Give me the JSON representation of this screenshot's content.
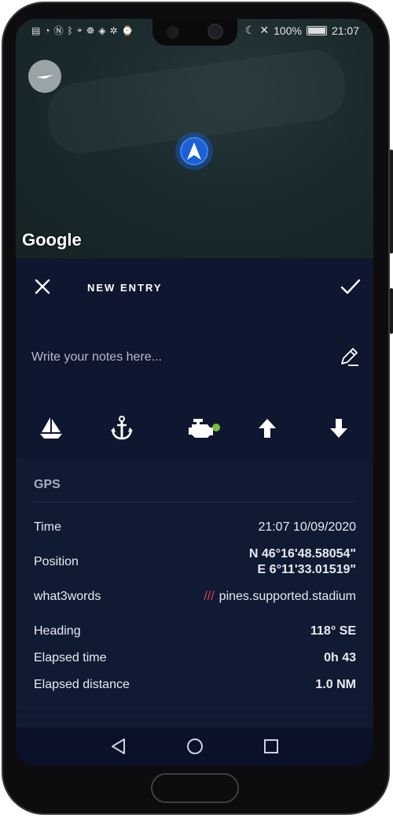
{
  "status": {
    "battery": "100%",
    "time": "21:07",
    "left_icons": [
      "data-icon",
      "wifi-icon",
      "nfc-icon",
      "bluetooth-icon",
      "location-icon",
      "helm-icon",
      "target-icon",
      "settings-icon",
      "watch-icon"
    ],
    "right_icons": [
      "moon-icon",
      "mute-icon",
      "battery-icon"
    ]
  },
  "map": {
    "provider": "Google"
  },
  "header": {
    "title": "NEW ENTRY"
  },
  "notes": {
    "placeholder": "Write your notes here..."
  },
  "quick_actions": [
    "sailboat-icon",
    "anchor-icon",
    "engine-icon",
    "arrow-up-icon",
    "arrow-down-icon"
  ],
  "engine_status_color": "#7bbf3a",
  "gps": {
    "title": "GPS",
    "time_label": "Time",
    "time_value": "21:07 10/09/2020",
    "position_label": "Position",
    "position_lat": "N 46°16'48.58054\"",
    "position_lon": "E 6°11'33.01519\"",
    "w3w_label": "what3words",
    "w3w_prefix": "///",
    "w3w_value": "pines.supported.stadium",
    "heading_label": "Heading",
    "heading_value": "118° SE",
    "elapsed_time_label": "Elapsed time",
    "elapsed_time_value": "0h 43",
    "elapsed_distance_label": "Elapsed distance",
    "elapsed_distance_value": "1.0 NM"
  },
  "colors": {
    "accent_w3w": "#e0424a",
    "background": "#0f1730",
    "card": "#111a33"
  }
}
